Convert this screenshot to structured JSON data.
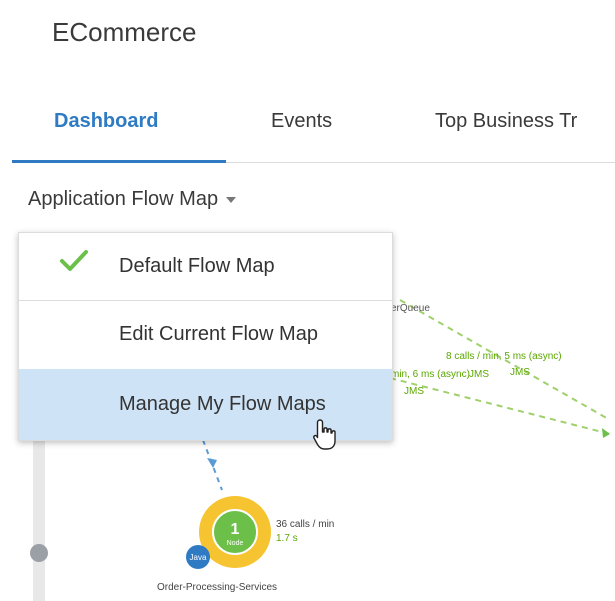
{
  "app": {
    "title": "ECommerce"
  },
  "tabs": [
    {
      "label": "Dashboard",
      "active": true
    },
    {
      "label": "Events",
      "active": false
    },
    {
      "label": "Top Business Tr",
      "active": false
    }
  ],
  "flow_map_selector": {
    "label": "Application Flow Map",
    "icon": "caret-down-icon"
  },
  "menu": {
    "items": [
      {
        "label": "Default Flow Map",
        "checked": true,
        "icon": "checkmark-icon"
      },
      {
        "label": "Edit Current Flow Map",
        "checked": false
      },
      {
        "label": "Manage My Flow Maps",
        "checked": false,
        "hovered": true
      }
    ]
  },
  "flow_map": {
    "queue_label": "erQueue",
    "edge_1": {
      "calls": "8 calls / min, 5 ms (async)",
      "type": "JMS"
    },
    "edge_2": {
      "calls": "min, 6 ms (async)",
      "type": "JMS",
      "type2": "JMS"
    },
    "node": {
      "count": "1",
      "count_label": "Node",
      "name": "Order-Processing-Services",
      "badge": "Java",
      "calls": "36 calls / min",
      "time": "1.7 s"
    }
  },
  "colors": {
    "accent": "#2e7bc4",
    "check": "#6cc04a",
    "menu_hover": "#cfe3f7",
    "flow_text": "#5aa800",
    "node_ring": "#f7c431",
    "node_core": "#6cc04a"
  }
}
